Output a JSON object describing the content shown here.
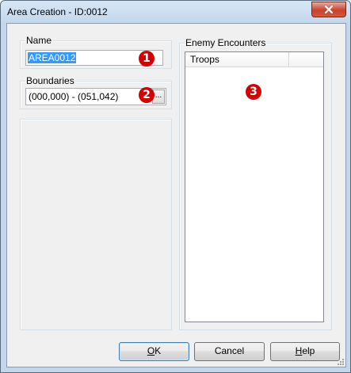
{
  "window": {
    "title": "Area Creation - ID:0012"
  },
  "name_group": {
    "legend": "Name",
    "value": "AREA0012",
    "badge": "1"
  },
  "boundaries_group": {
    "legend": "Boundaries",
    "value": "(000,000) - (051,042)",
    "button_label": "...",
    "badge": "2"
  },
  "encounters_group": {
    "legend": "Enemy Encounters",
    "columns": [
      "Troops",
      ""
    ],
    "rows": [],
    "badge": "3"
  },
  "buttons": {
    "ok": {
      "mnemonic": "O",
      "rest": "K"
    },
    "cancel": {
      "label": "Cancel"
    },
    "help": {
      "mnemonic": "H",
      "rest": "elp"
    }
  },
  "colors": {
    "selection": "#3399ff",
    "badge": "#d40000",
    "close_button": "#c8412c"
  }
}
